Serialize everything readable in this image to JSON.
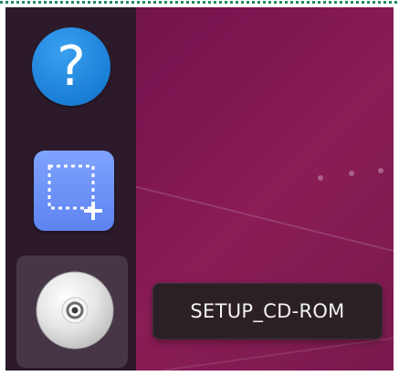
{
  "top_border": {
    "color": "#1f8a62"
  },
  "desktop": {
    "background_colors": [
      "#6a1247",
      "#8a1c56"
    ]
  },
  "dock": {
    "background": "#2c1a2b",
    "items": [
      {
        "name": "help",
        "icon": "help-icon",
        "glyph": "?",
        "color": "#1a7fd6",
        "active": false
      },
      {
        "name": "screenshot",
        "icon": "screenshot-icon",
        "color": "#6b8ff8",
        "active": false
      },
      {
        "name": "setup-cd-rom",
        "icon": "cd-disc-icon",
        "active": true
      }
    ]
  },
  "tooltip": {
    "label": "SETUP_CD-ROM"
  }
}
